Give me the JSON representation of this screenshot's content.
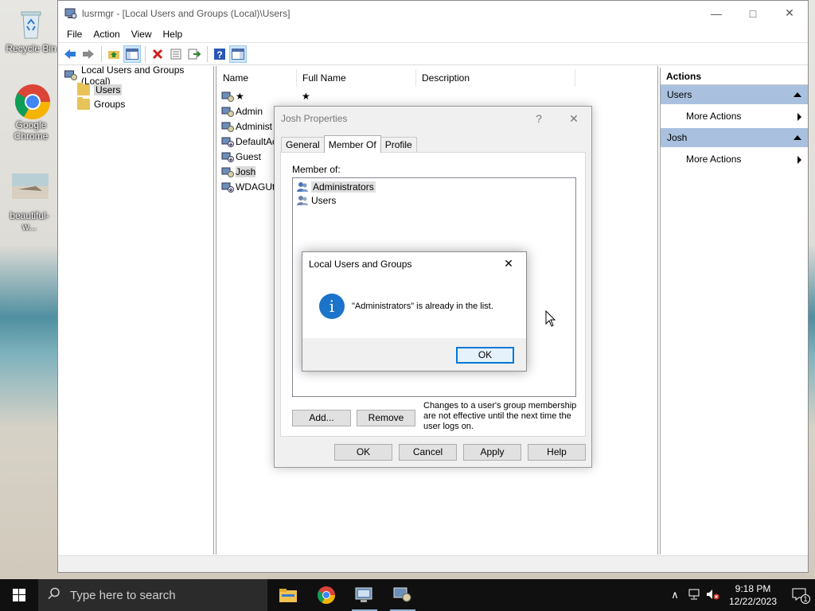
{
  "desktop": {
    "icons": [
      {
        "label": "Recycle Bin"
      },
      {
        "label": "Google Chrome"
      },
      {
        "label": "beautiful-w..."
      }
    ]
  },
  "window": {
    "title": "lusrmgr - [Local Users and Groups (Local)\\Users]",
    "menu": [
      "File",
      "Action",
      "View",
      "Help"
    ]
  },
  "tree": {
    "root": "Local Users and Groups (Local)",
    "items": [
      "Users",
      "Groups"
    ]
  },
  "list": {
    "columns": [
      "Name",
      "Full Name",
      "Description"
    ],
    "rows": [
      {
        "name": "★",
        "full_name": "★"
      },
      {
        "name": "Admin",
        "full_name": ""
      },
      {
        "name": "Administ",
        "full_name": ""
      },
      {
        "name": "DefaultAc",
        "full_name": ""
      },
      {
        "name": "Guest",
        "full_name": ""
      },
      {
        "name": "Josh",
        "full_name": ""
      },
      {
        "name": "WDAGUti",
        "full_name": ""
      }
    ]
  },
  "actions": {
    "title": "Actions",
    "sections": [
      {
        "header": "Users",
        "item": "More Actions"
      },
      {
        "header": "Josh",
        "item": "More Actions"
      }
    ]
  },
  "properties": {
    "title": "Josh Properties",
    "help_glyph": "?",
    "tabs": [
      "General",
      "Member Of",
      "Profile"
    ],
    "active_tab": "Member Of",
    "member_of_label": "Member of:",
    "members": [
      "Administrators",
      "Users"
    ],
    "add_button": "Add...",
    "remove_button": "Remove",
    "note": "Changes to a user's group membership are not effective until the next time the user logs on.",
    "buttons": [
      "OK",
      "Cancel",
      "Apply",
      "Help"
    ]
  },
  "message_box": {
    "title": "Local Users and Groups",
    "text": "\"Administrators\" is already in the list.",
    "ok": "OK"
  },
  "taskbar": {
    "search_placeholder": "Type here to search",
    "time": "9:18 PM",
    "date": "12/22/2023",
    "notification_count": "1"
  }
}
